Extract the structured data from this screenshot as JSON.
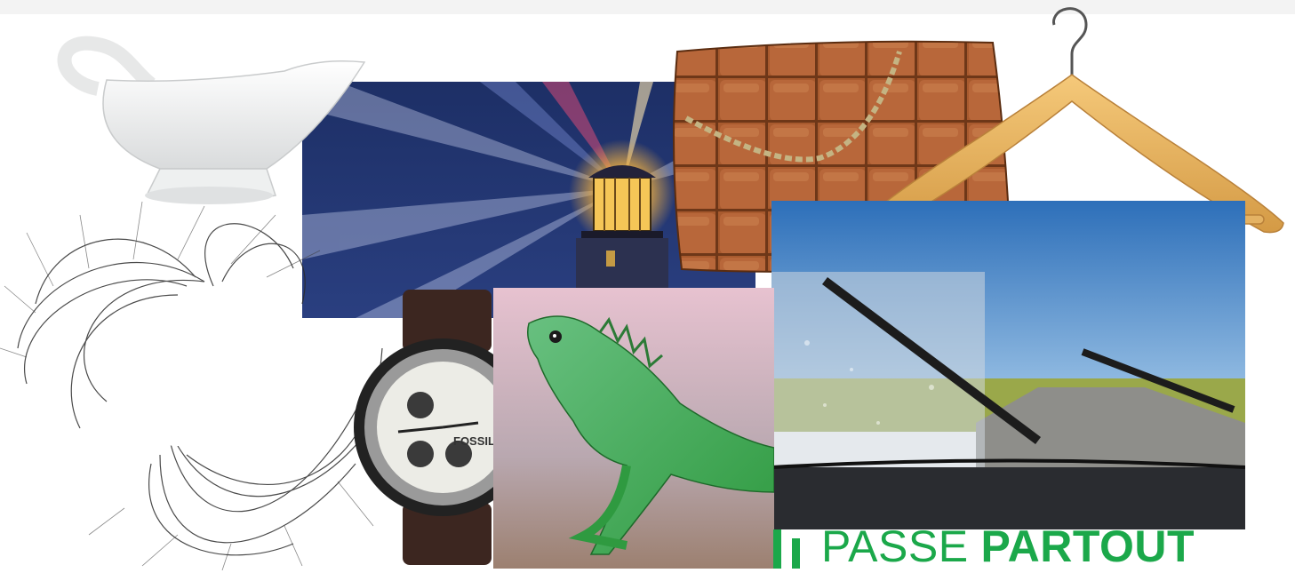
{
  "logo": {
    "word_light": "PASSE",
    "word_bold": "PARTOUT",
    "color": "#1ba84a"
  },
  "watch": {
    "brand": "FOSSIL"
  },
  "images": [
    "lighthouse-at-night",
    "gravy-boat",
    "woven-leather-bag",
    "wooden-hanger",
    "windshield-wiper",
    "false-eyelashes",
    "wristwatch",
    "iguana"
  ]
}
